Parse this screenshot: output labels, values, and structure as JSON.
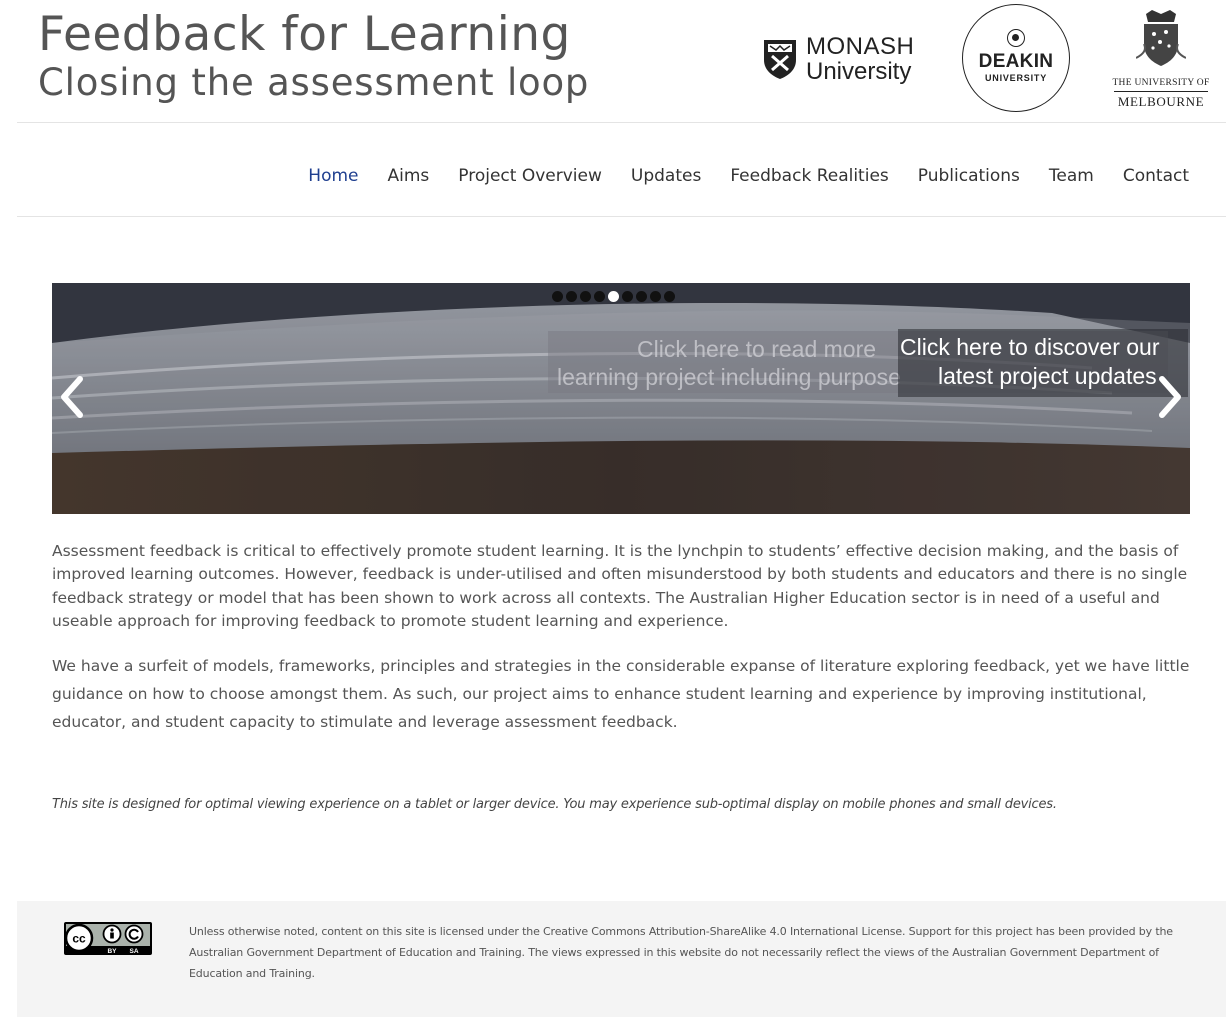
{
  "header": {
    "title_line1": "Feedback for Learning",
    "title_line2": "Closing the assessment loop"
  },
  "logos": {
    "monash": {
      "line1": "MONASH",
      "line2": "University",
      "icon": "monash-shield-icon"
    },
    "deakin": {
      "name": "DEAKIN",
      "sub": "UNIVERSITY",
      "icon": "deakin-emblem-icon"
    },
    "melbourne": {
      "line1": "THE UNIVERSITY OF",
      "line2": "MELBOURNE",
      "icon": "melbourne-crest-icon"
    }
  },
  "nav": {
    "items": [
      {
        "label": "Home",
        "active": true
      },
      {
        "label": "Aims"
      },
      {
        "label": "Project Overview"
      },
      {
        "label": "Updates"
      },
      {
        "label": "Feedback Realities"
      },
      {
        "label": "Publications"
      },
      {
        "label": "Team"
      },
      {
        "label": "Contact"
      }
    ],
    "active_color": "#1f3f8f"
  },
  "slider": {
    "dot_count": 9,
    "active_dot": 4,
    "ghost_caption_line1": "Click here to read more",
    "ghost_caption_line2": "learning project including purpose",
    "caption_line1": "Click here to discover our",
    "caption_line2": "latest project updates",
    "prev_icon": "chevron-left-icon",
    "next_icon": "chevron-right-icon"
  },
  "content": {
    "paragraph1": "Assessment feedback is critical to effectively promote student learning. It is the lynchpin to students’ effective decision making, and the basis of improved learning outcomes. However, feedback is under-utilised and often misunderstood by both students and educators and there is no single feedback strategy or model that has been shown to work across all contexts. The Australian Higher Education sector is in need of a useful and useable approach for improving feedback to promote student learning and experience.",
    "paragraph2": "We have a surfeit of models, frameworks, principles and strategies in the considerable expanse of literature exploring feedback, yet we have little guidance on how to choose amongst them. As such, our project aims to enhance student learning and experience by improving institutional, educator, and student capacity to stimulate and leverage assessment feedback.",
    "device_note": "This site is designed for optimal viewing experience on a tablet or larger device. You may experience sub-optimal display on mobile phones and small devices."
  },
  "footer": {
    "license_icon": "cc-by-sa-icon",
    "license_by": "BY",
    "license_sa": "SA",
    "text": "Unless otherwise noted, content on this site is licensed under the Creative Commons Attribution-ShareAlike 4.0 International License. Support for this project has been provided by the Australian Government Department of Education and Training. The views expressed in this website do not necessarily reflect the views of the Australian Government Department of Education and Training."
  }
}
